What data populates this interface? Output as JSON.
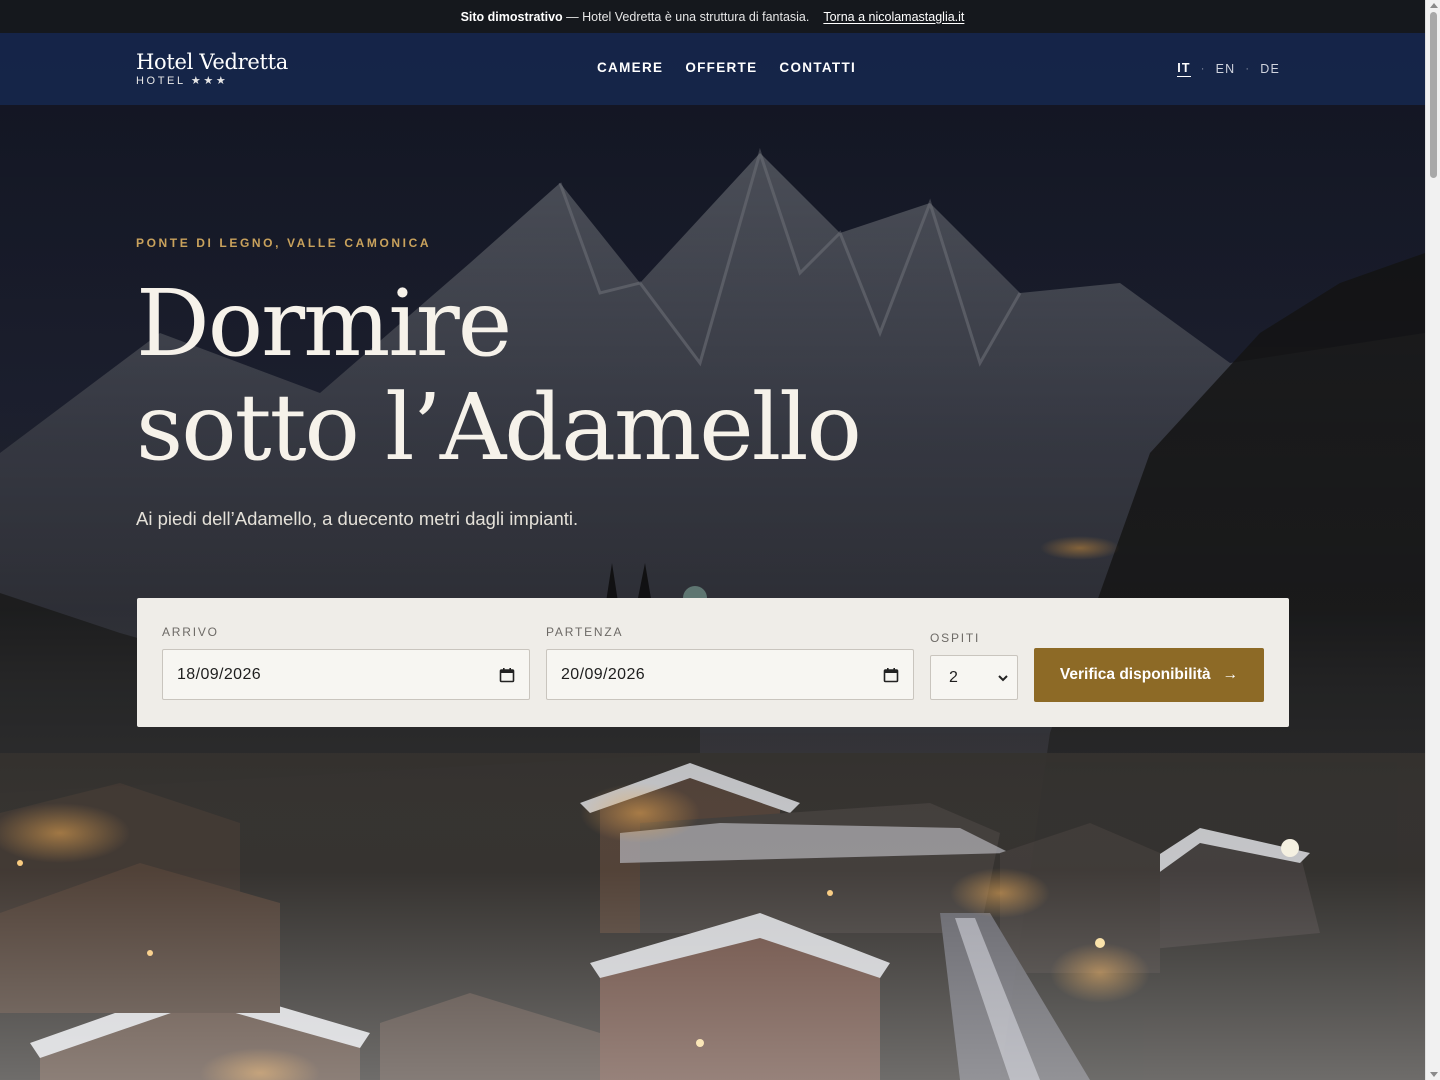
{
  "demo_bar": {
    "bold": "Sito dimostrativo",
    "text": "— Hotel Vedretta è una struttura di fantasia.",
    "link": "Torna a nicolamastaglia.it"
  },
  "header": {
    "brand_name": "Hotel Vedretta",
    "brand_sub": "HOTEL ★★★",
    "nav": [
      "CAMERE",
      "OFFERTE",
      "CONTATTI"
    ],
    "languages": [
      "IT",
      "EN",
      "DE"
    ],
    "active_language": "IT",
    "lang_separator": "·"
  },
  "hero": {
    "eyebrow": "PONTE DI LEGNO, VALLE CAMONICA",
    "title_line1": "Dormire",
    "title_line2": "sotto l’Adamello",
    "subtitle": "Ai piedi dell’Adamello, a duecento metri dagli impianti.",
    "background_icon": "mountain-village-night-photo"
  },
  "booking": {
    "arrival_label": "ARRIVO",
    "arrival_value": "18/09/2026",
    "departure_label": "PARTENZA",
    "departure_value": "20/09/2026",
    "guests_label": "OSPITI",
    "guests_value": "2",
    "cta_label": "Verifica disponibilità",
    "cta_arrow": "→"
  },
  "colors": {
    "accent_gold": "#c9a25c",
    "cta_brown": "#8d6a26",
    "header_navy": "#162850"
  }
}
